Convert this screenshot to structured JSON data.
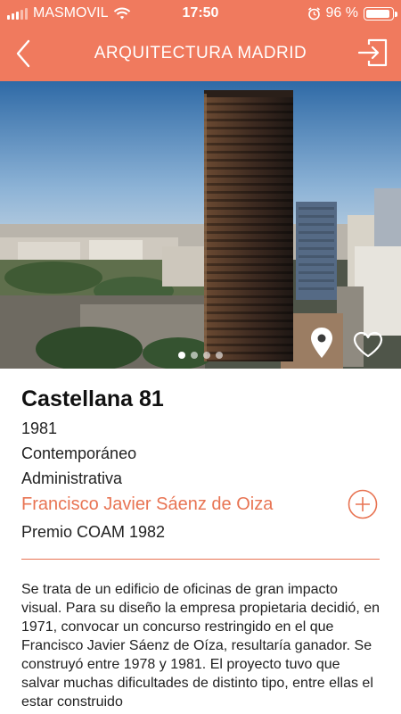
{
  "status_bar": {
    "carrier": "MASMOVIL",
    "time": "17:50",
    "battery_percent": "96 %",
    "battery_level": 0.96
  },
  "header": {
    "title": "ARQUITECTURA MADRID"
  },
  "gallery": {
    "photo_count": 4,
    "active_index": 0
  },
  "building": {
    "name": "Castellana 81",
    "year": "1981",
    "style": "Contemporáneo",
    "type": "Administrativa",
    "architect": "Francisco Javier Sáenz de Oiza",
    "award": "Premio COAM 1982",
    "description": "Se trata de un edificio de oficinas de gran impacto visual. Para su diseño la empresa propietaria decidió, en 1971, convocar un concurso restringido en el que Francisco Javier Sáenz de Oíza, resultaría ganador. Se construyó entre 1978 y 1981. El proyecto tuvo que salvar muchas dificultades de distinto tipo, entre ellas el estar construido"
  },
  "colors": {
    "accent": "#f07a5e",
    "architect_link": "#e87453"
  },
  "icons": {
    "back": "chevron-left-icon",
    "exit": "exit-icon",
    "location": "map-pin-icon",
    "favorite": "heart-outline-icon",
    "expand": "plus-circle-icon"
  }
}
